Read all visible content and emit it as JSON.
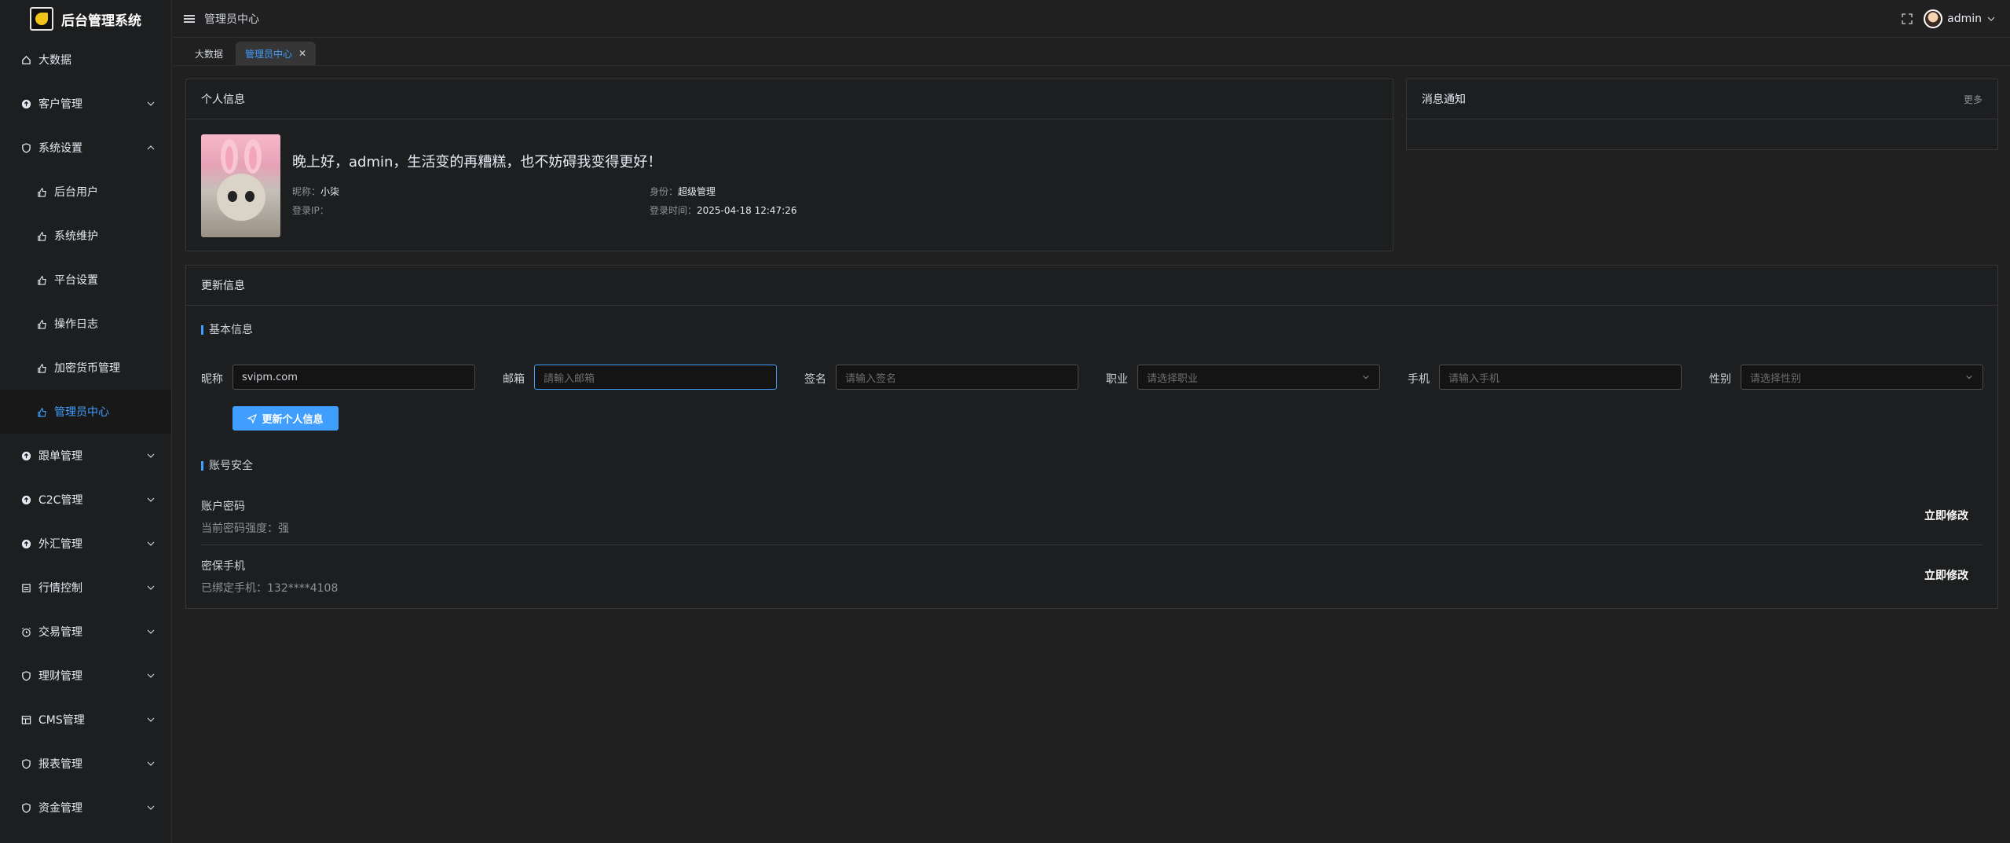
{
  "app": {
    "title": "后台管理系统"
  },
  "sidebar": {
    "items": [
      {
        "label": "大数据",
        "icon": "home-icon"
      },
      {
        "label": "客户管理",
        "icon": "circle-up-icon"
      },
      {
        "label": "系统设置",
        "icon": "shield-icon"
      },
      {
        "label": "后台用户",
        "icon": "thumb-icon"
      },
      {
        "label": "系统维护",
        "icon": "thumb-icon"
      },
      {
        "label": "平台设置",
        "icon": "thumb-icon"
      },
      {
        "label": "操作日志",
        "icon": "thumb-icon"
      },
      {
        "label": "加密货币管理",
        "icon": "thumb-icon"
      },
      {
        "label": "管理员中心",
        "icon": "thumb-icon"
      },
      {
        "label": "跟单管理",
        "icon": "circle-up-icon"
      },
      {
        "label": "C2C管理",
        "icon": "circle-up-icon"
      },
      {
        "label": "外汇管理",
        "icon": "circle-up-icon"
      },
      {
        "label": "行情控制",
        "icon": "monitor-icon"
      },
      {
        "label": "交易管理",
        "icon": "alarm-icon"
      },
      {
        "label": "理财管理",
        "icon": "shield-icon"
      },
      {
        "label": "CMS管理",
        "icon": "layout-icon"
      },
      {
        "label": "报表管理",
        "icon": "shield-icon"
      },
      {
        "label": "资金管理",
        "icon": "shield-icon"
      }
    ]
  },
  "header": {
    "breadcrumb": "管理员中心",
    "user": "admin"
  },
  "tabs": [
    {
      "label": "大数据"
    },
    {
      "label": "管理员中心"
    }
  ],
  "profile": {
    "title": "个人信息",
    "greeting": "晚上好，admin，生活变的再糟糕，也不妨碍我变得更好！",
    "nickname_label": "昵称：",
    "nickname": "小柒",
    "identity_label": "身份：",
    "identity": "超级管理",
    "ip_label": "登录IP：",
    "ip": "",
    "time_label": "登录时间：",
    "time": "2025-04-18 12:47:26"
  },
  "notice": {
    "title": "消息通知",
    "more": "更多"
  },
  "update": {
    "title": "更新信息",
    "basic_title": "基本信息",
    "fields": {
      "nickname": {
        "label": "昵称",
        "value": "svipm.com"
      },
      "email": {
        "label": "邮箱",
        "placeholder": "請輸入邮箱"
      },
      "sign": {
        "label": "签名",
        "placeholder": "请输入签名"
      },
      "job": {
        "label": "职业",
        "placeholder": "请选择职业"
      },
      "phone": {
        "label": "手机",
        "placeholder": "请输入手机"
      },
      "gender": {
        "label": "性别",
        "placeholder": "请选择性别"
      }
    },
    "submit": "更新个人信息",
    "security_title": "账号安全",
    "password": {
      "title": "账户密码",
      "desc": "当前密码强度：强",
      "action": "立即修改"
    },
    "phone_sec": {
      "title": "密保手机",
      "desc": "已绑定手机：132****4108",
      "action": "立即修改"
    }
  }
}
